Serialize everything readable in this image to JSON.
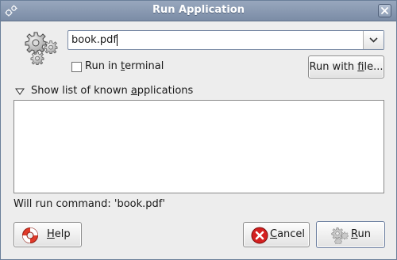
{
  "window": {
    "title": "Run Application"
  },
  "command": {
    "value": "book.pdf"
  },
  "terminal_option": {
    "pre": "Run in ",
    "mnemonic": "t",
    "post": "erminal",
    "checked": false
  },
  "run_with_file": {
    "pre": "Run with ",
    "mnemonic": "f",
    "post": "ile..."
  },
  "known_apps": {
    "pre": "Show list of known ",
    "mnemonic": "a",
    "post": "pplications",
    "expanded": true,
    "items": []
  },
  "status": {
    "text": "Will run command: 'book.pdf'"
  },
  "buttons": {
    "help": {
      "mnemonic": "H",
      "post": "elp",
      "icon": "lifebuoy-icon"
    },
    "cancel": {
      "mnemonic": "C",
      "post": "ancel",
      "icon": "cancel-icon"
    },
    "run": {
      "mnemonic": "R",
      "post": "un",
      "icon": "gears-icon"
    }
  },
  "colors": {
    "titlebar": "#8a9ab1",
    "window_bg": "#ededed",
    "cancel_red": "#d42020",
    "lifebuoy_red": "#e03a2a"
  }
}
